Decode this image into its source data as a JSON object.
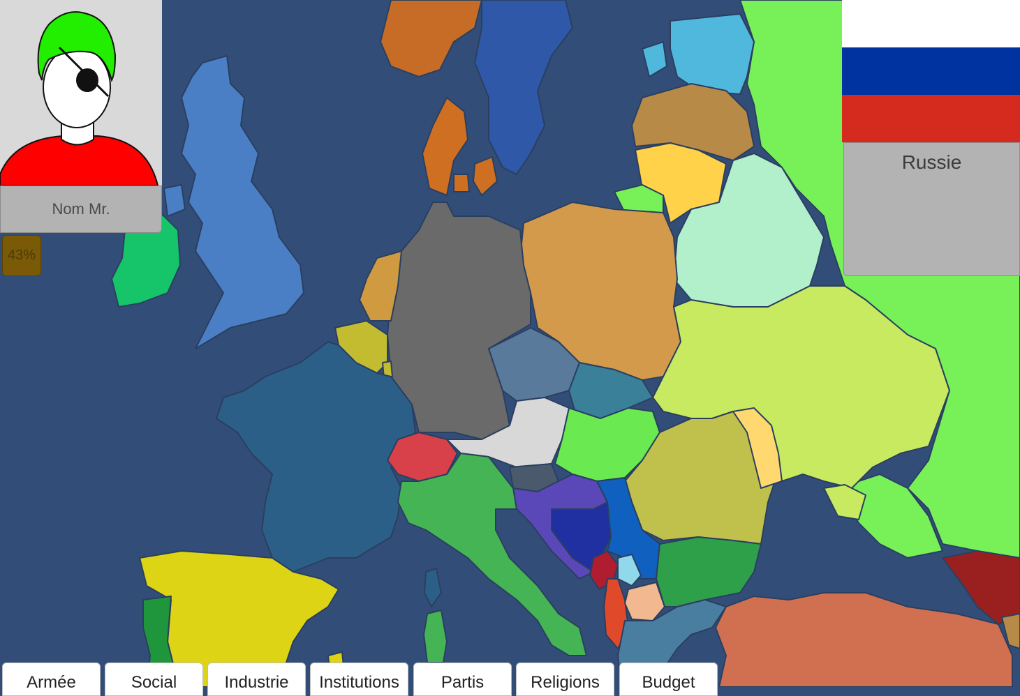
{
  "leader": {
    "name": "Nom Mr.",
    "approval": "43%",
    "colors": {
      "hair": "#22ee00",
      "shirt": "#ff0000",
      "face": "#ffffff",
      "background": "#d9d9d9"
    }
  },
  "country": {
    "name": "Russie",
    "flag_colors": [
      "#ffffff",
      "#0033a0",
      "#d52b1e"
    ]
  },
  "tabs": [
    {
      "label": "Armée"
    },
    {
      "label": "Social"
    },
    {
      "label": "Industrie"
    },
    {
      "label": "Institutions"
    },
    {
      "label": "Partis"
    },
    {
      "label": "Religions"
    },
    {
      "label": "Budget"
    }
  ],
  "map": {
    "sea_color": "#324e78",
    "regions": [
      {
        "name": "norway",
        "color": "#c76c26"
      },
      {
        "name": "sweden",
        "color": "#2f59a8"
      },
      {
        "name": "finland",
        "color": "#4fb8dc"
      },
      {
        "name": "russia",
        "color": "#78f058"
      },
      {
        "name": "denmark",
        "color": "#cf6f22"
      },
      {
        "name": "united-kingdom",
        "color": "#4a7fc6"
      },
      {
        "name": "ireland",
        "color": "#16c46a"
      },
      {
        "name": "latvia",
        "color": "#b88a48"
      },
      {
        "name": "lithuania",
        "color": "#ffd24a"
      },
      {
        "name": "kaliningrad",
        "color": "#78f058"
      },
      {
        "name": "belarus",
        "color": "#b2f0cc"
      },
      {
        "name": "poland",
        "color": "#d49a4c"
      },
      {
        "name": "germany",
        "color": "#6a6a6a"
      },
      {
        "name": "netherlands",
        "color": "#d09a40"
      },
      {
        "name": "belgium",
        "color": "#c4bc30"
      },
      {
        "name": "france",
        "color": "#2c5f88"
      },
      {
        "name": "czechia",
        "color": "#5a7a9c"
      },
      {
        "name": "slovakia",
        "color": "#3a8098"
      },
      {
        "name": "austria",
        "color": "#d8d8d8"
      },
      {
        "name": "switzerland",
        "color": "#d8404a"
      },
      {
        "name": "ukraine",
        "color": "#c8ea60"
      },
      {
        "name": "hungary",
        "color": "#6aea50"
      },
      {
        "name": "romania",
        "color": "#c0c04c"
      },
      {
        "name": "moldova",
        "color": "#ffd870"
      },
      {
        "name": "slovenia",
        "color": "#4a5a6c"
      },
      {
        "name": "croatia",
        "color": "#5a48b8"
      },
      {
        "name": "bosnia",
        "color": "#2030a0"
      },
      {
        "name": "serbia",
        "color": "#1060c0"
      },
      {
        "name": "montenegro",
        "color": "#b01c30"
      },
      {
        "name": "kosovo",
        "color": "#90d8ea"
      },
      {
        "name": "albania",
        "color": "#e04a2a"
      },
      {
        "name": "macedonia",
        "color": "#f2b890"
      },
      {
        "name": "bulgaria",
        "color": "#2ea04a"
      },
      {
        "name": "greece",
        "color": "#4a7ea0"
      },
      {
        "name": "turkey",
        "color": "#d07050"
      },
      {
        "name": "georgia",
        "color": "#9a2020"
      },
      {
        "name": "italy",
        "color": "#44b454"
      },
      {
        "name": "spain",
        "color": "#dcd414"
      },
      {
        "name": "portugal",
        "color": "#20963c"
      },
      {
        "name": "sardinia",
        "color": "#44b454"
      }
    ]
  }
}
